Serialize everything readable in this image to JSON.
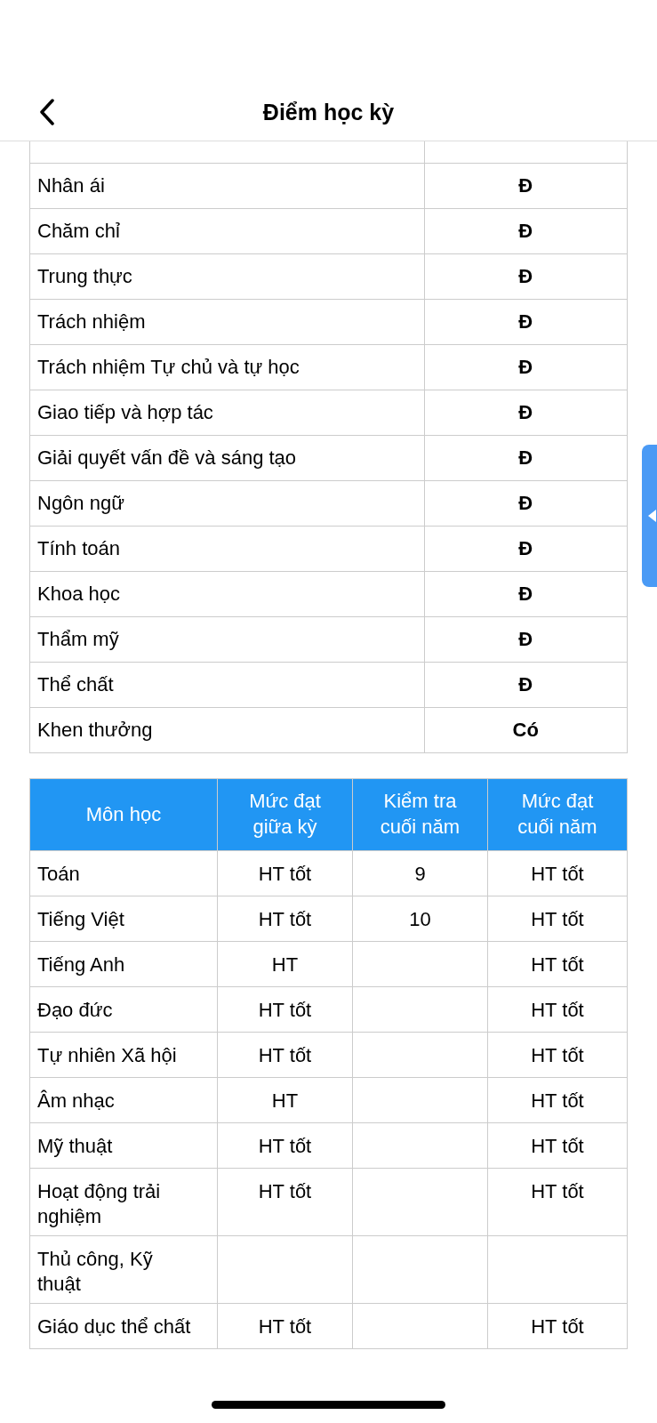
{
  "header": {
    "title": "Điểm học kỳ"
  },
  "qualities": [
    {
      "name": "Nhân ái",
      "value": "Đ"
    },
    {
      "name": "Chăm chỉ",
      "value": "Đ"
    },
    {
      "name": "Trung thực",
      "value": "Đ"
    },
    {
      "name": "Trách nhiệm",
      "value": "Đ"
    },
    {
      "name": "Trách nhiệm Tự chủ và tự học",
      "value": "Đ"
    },
    {
      "name": "Giao tiếp và hợp tác",
      "value": "Đ"
    },
    {
      "name": "Giải quyết vấn đề và sáng tạo",
      "value": "Đ"
    },
    {
      "name": "Ngôn ngữ",
      "value": "Đ"
    },
    {
      "name": "Tính toán",
      "value": "Đ"
    },
    {
      "name": "Khoa học",
      "value": "Đ"
    },
    {
      "name": "Thẩm mỹ",
      "value": "Đ"
    },
    {
      "name": "Thể chất",
      "value": "Đ"
    },
    {
      "name": "Khen thưởng",
      "value": "Có"
    }
  ],
  "grades": {
    "columns": [
      "Môn học",
      "Mức đạt giữa kỳ",
      "Kiểm tra cuối năm",
      "Mức đạt cuối năm"
    ],
    "rows": [
      [
        "Toán",
        "HT tốt",
        "9",
        "HT tốt"
      ],
      [
        "Tiếng Việt",
        "HT tốt",
        "10",
        "HT tốt"
      ],
      [
        "Tiếng Anh",
        "HT",
        "",
        "HT tốt"
      ],
      [
        "Đạo đức",
        "HT tốt",
        "",
        "HT tốt"
      ],
      [
        "Tự nhiên Xã hội",
        "HT tốt",
        "",
        "HT tốt"
      ],
      [
        "Âm nhạc",
        "HT",
        "",
        "HT tốt"
      ],
      [
        "Mỹ thuật",
        "HT tốt",
        "",
        "HT tốt"
      ],
      [
        "Hoạt động trải nghiệm",
        "HT tốt",
        "",
        "HT tốt"
      ],
      [
        "Thủ công, Kỹ thuật",
        "",
        "",
        ""
      ],
      [
        "Giáo dục thể chất",
        "HT tốt",
        "",
        "HT tốt"
      ]
    ]
  }
}
